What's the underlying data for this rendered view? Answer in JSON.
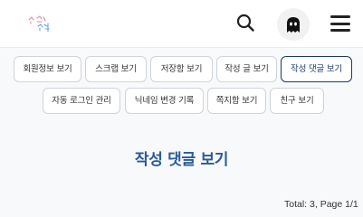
{
  "header": {
    "logo_text": "스 첫 서킨",
    "search_icon": "search-icon",
    "avatar_icon": "ghost-icon",
    "menu_icon": "hamburger-menu-icon"
  },
  "tabs": [
    {
      "label": "회원정보 보기",
      "active": false
    },
    {
      "label": "스크랩 보기",
      "active": false
    },
    {
      "label": "저장함 보기",
      "active": false
    },
    {
      "label": "작성 글 보기",
      "active": false
    },
    {
      "label": "작성 댓글 보기",
      "active": true
    },
    {
      "label": "자동 로그인 관리",
      "active": false
    },
    {
      "label": "닉네임 변경 기록",
      "active": false
    },
    {
      "label": "쪽지함 보기",
      "active": false
    },
    {
      "label": "친구 보기",
      "active": false
    }
  ],
  "main": {
    "title": "작성 댓글 보기",
    "pagination_info": "Total: 3, Page 1/1"
  },
  "colors": {
    "active_tab": "#1b3a6b",
    "title": "#2a5a9a",
    "background": "#f8f9fa"
  }
}
